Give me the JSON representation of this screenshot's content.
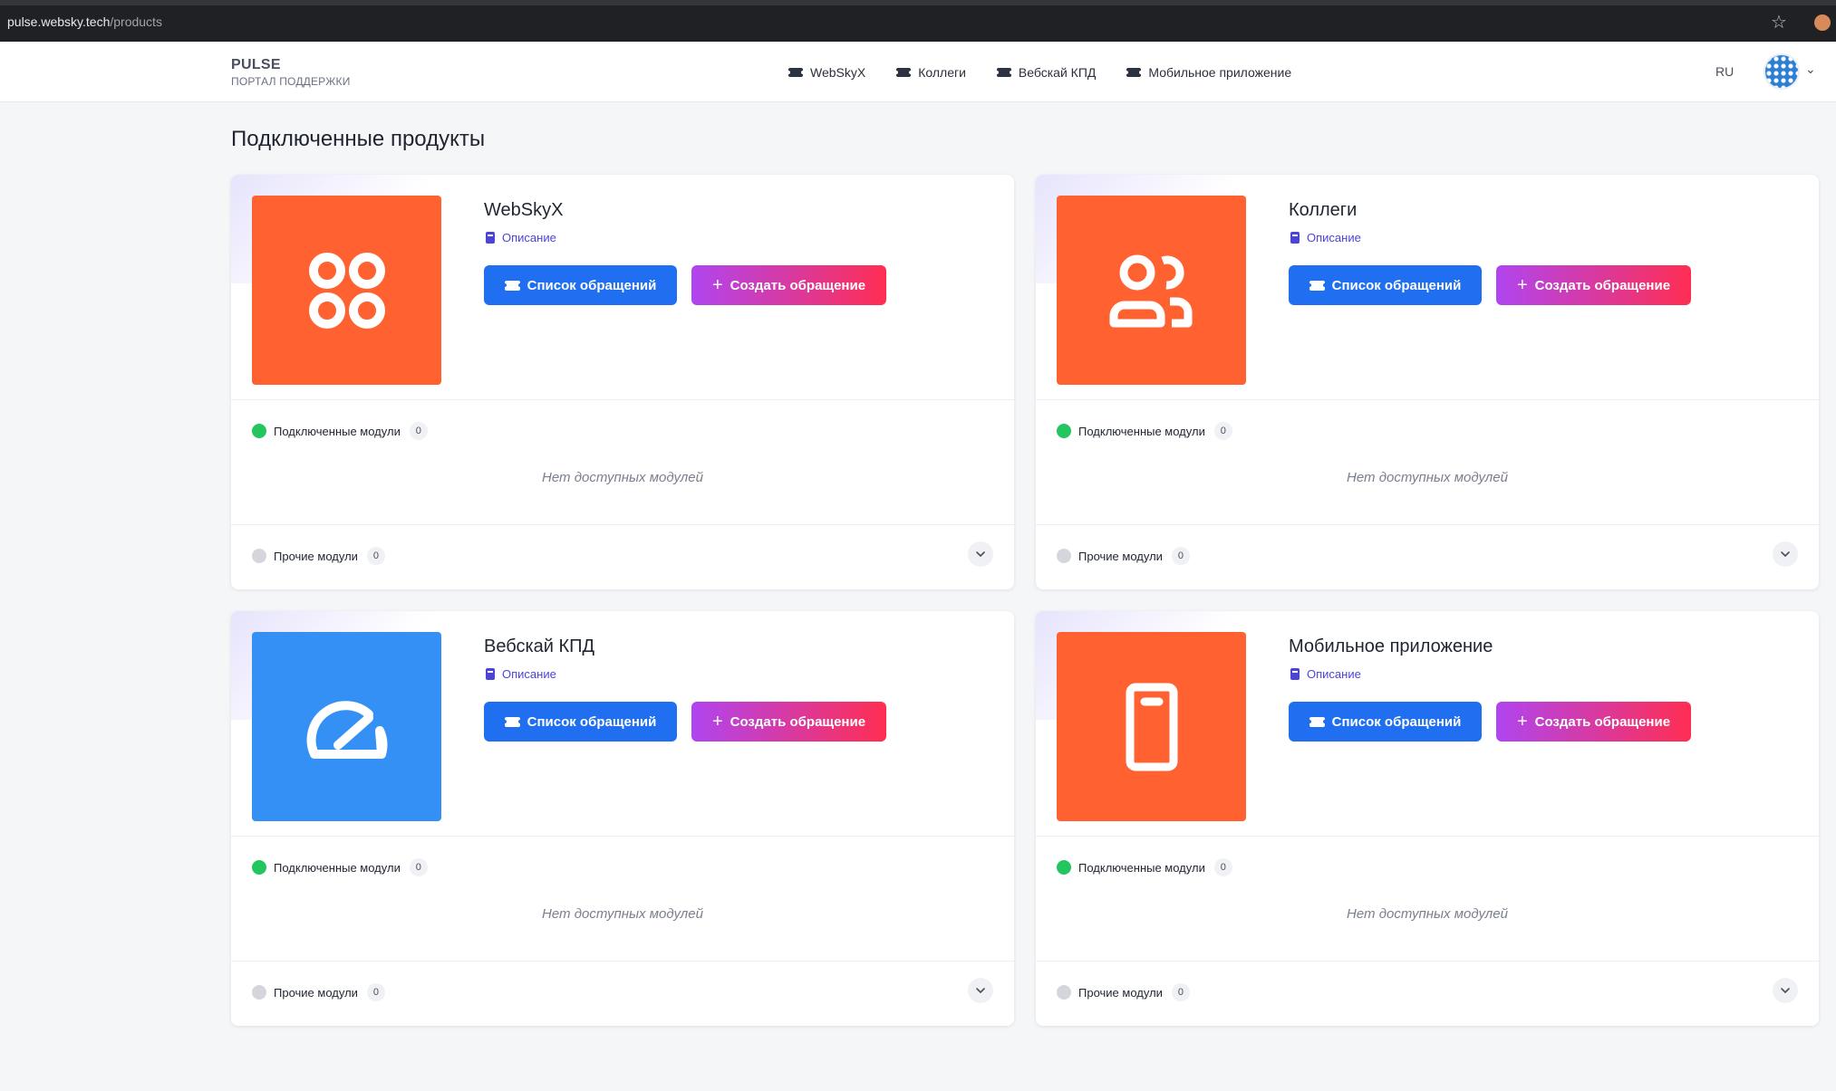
{
  "browser": {
    "url_host": "pulse.websky.tech",
    "url_path": "/products"
  },
  "header": {
    "brand_title": "PULSE",
    "brand_subtitle": "ПОРТАЛ ПОДДЕРЖКИ",
    "nav": [
      {
        "label": "WebSkyX"
      },
      {
        "label": "Коллеги"
      },
      {
        "label": "Вебскай КПД"
      },
      {
        "label": "Мобильное приложение"
      }
    ],
    "language": "RU"
  },
  "page": {
    "title": "Подключенные продукты"
  },
  "colors": {
    "orange_tile": "#ff6131",
    "blue_tile": "#3490f5",
    "primary_button": "#1f6ff0",
    "gradient_start": "#b045f0",
    "gradient_end": "#ff2e52",
    "connected_dot": "#22c55e"
  },
  "products": [
    {
      "name": "WebSkyX",
      "icon": "apps-grid-icon",
      "tile_color": "#ff6131",
      "description_label": "Описание",
      "list_button": "Список обращений",
      "create_button": "Создать обращение",
      "connected_label": "Подключенные модули",
      "connected_count": "0",
      "empty_text": "Нет доступных модулей",
      "other_label": "Прочие модули",
      "other_count": "0"
    },
    {
      "name": "Коллеги",
      "icon": "users-icon",
      "tile_color": "#ff6131",
      "description_label": "Описание",
      "list_button": "Список обращений",
      "create_button": "Создать обращение",
      "connected_label": "Подключенные модули",
      "connected_count": "0",
      "empty_text": "Нет доступных модулей",
      "other_label": "Прочие модули",
      "other_count": "0"
    },
    {
      "name": "Вебскай КПД",
      "icon": "speedometer-icon",
      "tile_color": "#3490f5",
      "description_label": "Описание",
      "list_button": "Список обращений",
      "create_button": "Создать обращение",
      "connected_label": "Подключенные модули",
      "connected_count": "0",
      "empty_text": "Нет доступных модулей",
      "other_label": "Прочие модули",
      "other_count": "0"
    },
    {
      "name": "Мобильное приложение",
      "icon": "mobile-phone-icon",
      "tile_color": "#ff6131",
      "description_label": "Описание",
      "list_button": "Список обращений",
      "create_button": "Создать обращение",
      "connected_label": "Подключенные модули",
      "connected_count": "0",
      "empty_text": "Нет доступных модулей",
      "other_label": "Прочие модули",
      "other_count": "0"
    }
  ]
}
